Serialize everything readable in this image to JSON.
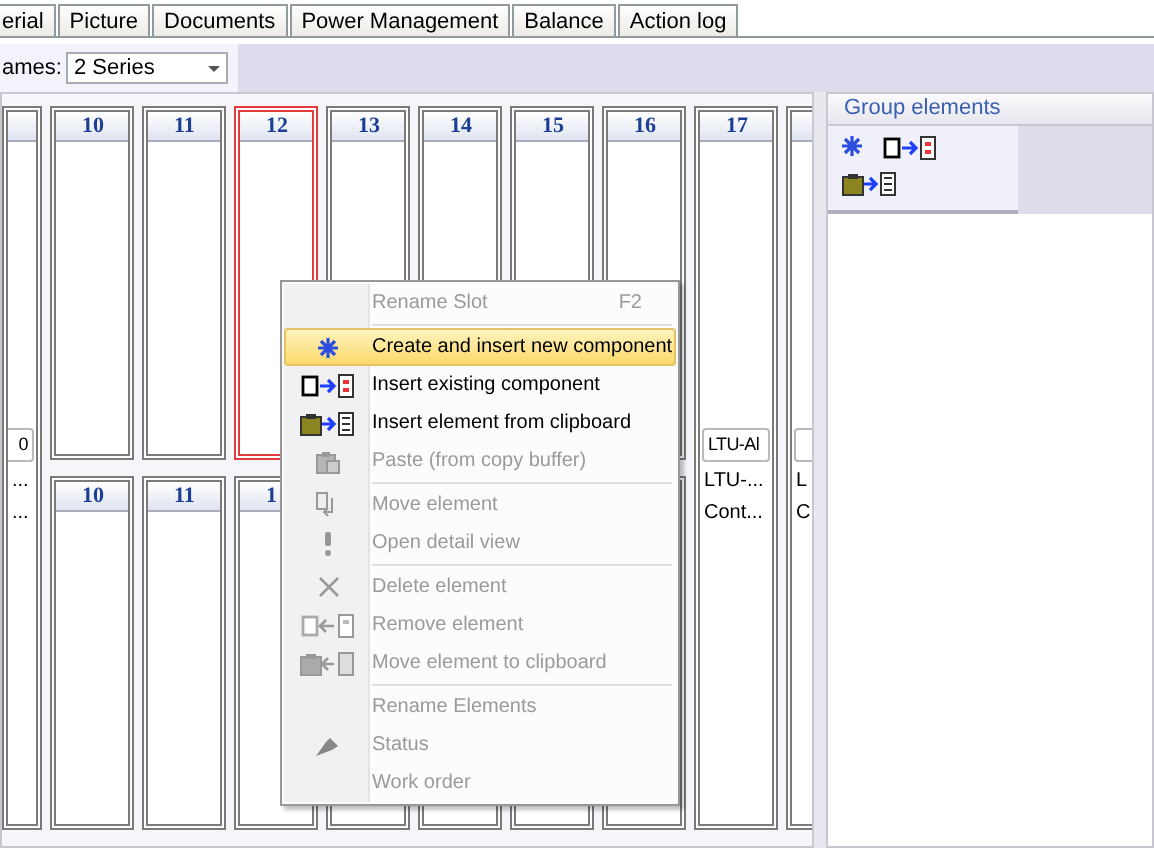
{
  "tabs": [
    {
      "label": "erial",
      "selected": false
    },
    {
      "label": "Picture",
      "selected": false
    },
    {
      "label": "Documents",
      "selected": false
    },
    {
      "label": "Power Management",
      "selected": false
    },
    {
      "label": "Balance",
      "selected": false
    },
    {
      "label": "Action log",
      "selected": false
    }
  ],
  "frames": {
    "label": "ames:",
    "value": "2 Series"
  },
  "columns": [
    {
      "kind": "component",
      "field": "0",
      "lines": [
        "...",
        "..."
      ]
    },
    {
      "kind": "pair",
      "slots": [
        {
          "number": "10",
          "selected": false
        },
        {
          "number": "10",
          "selected": false
        }
      ]
    },
    {
      "kind": "pair",
      "slots": [
        {
          "number": "11",
          "selected": false
        },
        {
          "number": "11",
          "selected": false
        }
      ]
    },
    {
      "kind": "pair",
      "slots": [
        {
          "number": "12",
          "selected": true
        },
        {
          "number": "1",
          "selected": false
        }
      ]
    },
    {
      "kind": "pair",
      "slots": [
        {
          "number": "13",
          "selected": false
        },
        {
          "selected": false
        }
      ]
    },
    {
      "kind": "pair",
      "slots": [
        {
          "number": "14",
          "selected": false
        },
        {
          "selected": false
        }
      ]
    },
    {
      "kind": "pair",
      "slots": [
        {
          "number": "15",
          "selected": false
        },
        {
          "selected": false
        }
      ]
    },
    {
      "kind": "pair",
      "slots": [
        {
          "number": "16",
          "selected": false
        },
        {
          "selected": false
        }
      ]
    },
    {
      "kind": "component",
      "number": "17",
      "field": "LTU-Al",
      "lines": [
        "LTU-...",
        "Cont..."
      ]
    },
    {
      "kind": "component",
      "lines": [
        "L",
        "C"
      ]
    }
  ],
  "group_panel": {
    "title": "Group elements"
  },
  "menu": {
    "items": [
      {
        "kind": "item",
        "label": "Rename Slot",
        "shortcut": "F2",
        "disabled": true,
        "selected": false
      },
      {
        "kind": "separator"
      },
      {
        "kind": "item",
        "label": "Create and insert new component",
        "disabled": false,
        "selected": true
      },
      {
        "kind": "item",
        "label": "Insert existing component",
        "disabled": false,
        "selected": false
      },
      {
        "kind": "item",
        "label": "Insert element from clipboard",
        "disabled": false,
        "selected": false
      },
      {
        "kind": "item",
        "label": "Paste (from copy buffer)",
        "disabled": true,
        "selected": false
      },
      {
        "kind": "separator"
      },
      {
        "kind": "item",
        "label": "Move element",
        "disabled": true,
        "selected": false
      },
      {
        "kind": "item",
        "label": "Open detail view",
        "disabled": true,
        "selected": false
      },
      {
        "kind": "separator"
      },
      {
        "kind": "item",
        "label": "Delete element",
        "disabled": true,
        "selected": false
      },
      {
        "kind": "item",
        "label": "Remove element",
        "disabled": true,
        "selected": false
      },
      {
        "kind": "item",
        "label": "Move element to clipboard",
        "disabled": true,
        "selected": false
      },
      {
        "kind": "separator"
      },
      {
        "kind": "item",
        "label": "Rename Elements",
        "disabled": true,
        "selected": false
      },
      {
        "kind": "item",
        "label": "Status",
        "disabled": true,
        "selected": false
      },
      {
        "kind": "item",
        "label": "Work order",
        "disabled": true,
        "selected": false
      }
    ]
  }
}
